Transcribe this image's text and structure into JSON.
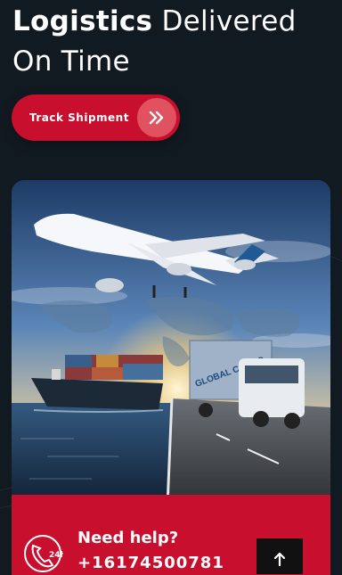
{
  "hero": {
    "title_strong": "Logistics",
    "title_rest": " Delivered",
    "title_line2": "On Time"
  },
  "cta": {
    "label": "Track Shipment",
    "icon": "double-chevron-right-icon"
  },
  "image": {
    "subject": "airplane, container ship and cargo truck over world map at sunset",
    "truck_text": "GLOBAL CARGO"
  },
  "help": {
    "title": "Need help?",
    "phone": "+16174500781",
    "icon": "phone-24h-icon",
    "badge": "24h"
  },
  "scroll_top": {
    "icon": "arrow-up-icon"
  },
  "colors": {
    "background": "#121a21",
    "accent": "#c8102e",
    "accent_light": "#e0525f"
  }
}
